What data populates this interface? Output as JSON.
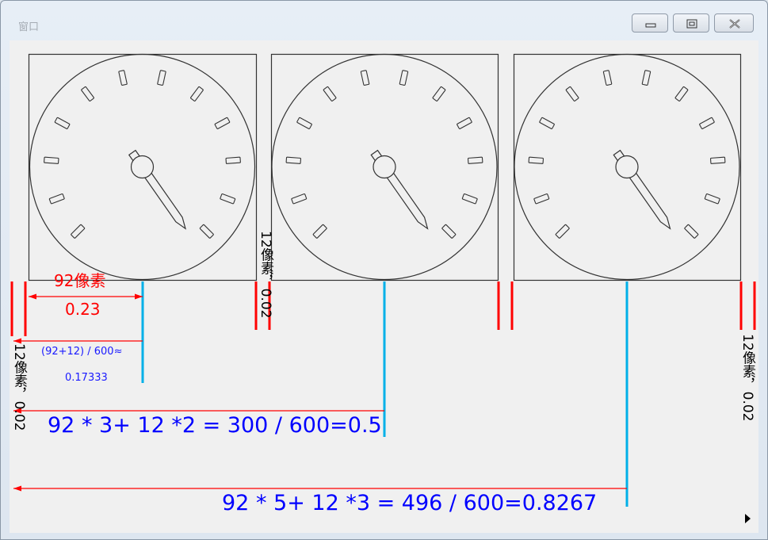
{
  "window": {
    "title": "窗口",
    "buttons": [
      "minimize",
      "maximize",
      "close"
    ]
  },
  "gauges": [
    {
      "name": "gauge-1"
    },
    {
      "name": "gauge-2"
    },
    {
      "name": "gauge-3"
    }
  ],
  "annotations": {
    "width_px": "92像素",
    "width_ratio": "0.23",
    "formula_small_1": "(92+12) / 600≈",
    "formula_small_2": "0.17333",
    "formula_2": "92 * 3+ 12 *2 = 300 / 600=0.5",
    "formula_3": "92 * 5+ 12 *3 = 496 / 600=0.8267",
    "gap_left": "12像素，0.02",
    "gap_middle": "12像素，0.02",
    "gap_right": "12像素，0.02"
  },
  "colors": {
    "red": "#ff0000",
    "blue": "#0000ff",
    "cyan": "#00b0e8",
    "dial": "#333333"
  }
}
